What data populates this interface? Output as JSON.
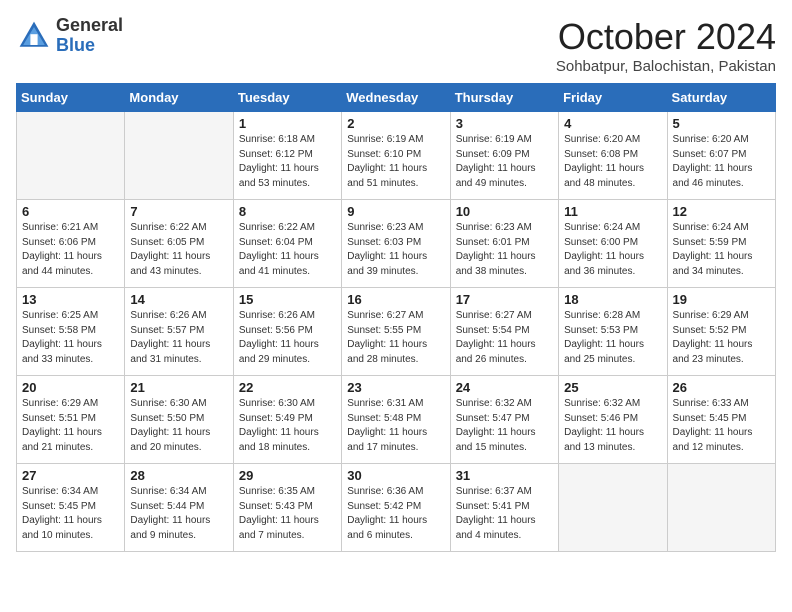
{
  "header": {
    "logo_general": "General",
    "logo_blue": "Blue",
    "month_title": "October 2024",
    "location": "Sohbatpur, Balochistan, Pakistan"
  },
  "days_of_week": [
    "Sunday",
    "Monday",
    "Tuesday",
    "Wednesday",
    "Thursday",
    "Friday",
    "Saturday"
  ],
  "weeks": [
    [
      {
        "day": "",
        "info": ""
      },
      {
        "day": "",
        "info": ""
      },
      {
        "day": "1",
        "info": "Sunrise: 6:18 AM\nSunset: 6:12 PM\nDaylight: 11 hours and 53 minutes."
      },
      {
        "day": "2",
        "info": "Sunrise: 6:19 AM\nSunset: 6:10 PM\nDaylight: 11 hours and 51 minutes."
      },
      {
        "day": "3",
        "info": "Sunrise: 6:19 AM\nSunset: 6:09 PM\nDaylight: 11 hours and 49 minutes."
      },
      {
        "day": "4",
        "info": "Sunrise: 6:20 AM\nSunset: 6:08 PM\nDaylight: 11 hours and 48 minutes."
      },
      {
        "day": "5",
        "info": "Sunrise: 6:20 AM\nSunset: 6:07 PM\nDaylight: 11 hours and 46 minutes."
      }
    ],
    [
      {
        "day": "6",
        "info": "Sunrise: 6:21 AM\nSunset: 6:06 PM\nDaylight: 11 hours and 44 minutes."
      },
      {
        "day": "7",
        "info": "Sunrise: 6:22 AM\nSunset: 6:05 PM\nDaylight: 11 hours and 43 minutes."
      },
      {
        "day": "8",
        "info": "Sunrise: 6:22 AM\nSunset: 6:04 PM\nDaylight: 11 hours and 41 minutes."
      },
      {
        "day": "9",
        "info": "Sunrise: 6:23 AM\nSunset: 6:03 PM\nDaylight: 11 hours and 39 minutes."
      },
      {
        "day": "10",
        "info": "Sunrise: 6:23 AM\nSunset: 6:01 PM\nDaylight: 11 hours and 38 minutes."
      },
      {
        "day": "11",
        "info": "Sunrise: 6:24 AM\nSunset: 6:00 PM\nDaylight: 11 hours and 36 minutes."
      },
      {
        "day": "12",
        "info": "Sunrise: 6:24 AM\nSunset: 5:59 PM\nDaylight: 11 hours and 34 minutes."
      }
    ],
    [
      {
        "day": "13",
        "info": "Sunrise: 6:25 AM\nSunset: 5:58 PM\nDaylight: 11 hours and 33 minutes."
      },
      {
        "day": "14",
        "info": "Sunrise: 6:26 AM\nSunset: 5:57 PM\nDaylight: 11 hours and 31 minutes."
      },
      {
        "day": "15",
        "info": "Sunrise: 6:26 AM\nSunset: 5:56 PM\nDaylight: 11 hours and 29 minutes."
      },
      {
        "day": "16",
        "info": "Sunrise: 6:27 AM\nSunset: 5:55 PM\nDaylight: 11 hours and 28 minutes."
      },
      {
        "day": "17",
        "info": "Sunrise: 6:27 AM\nSunset: 5:54 PM\nDaylight: 11 hours and 26 minutes."
      },
      {
        "day": "18",
        "info": "Sunrise: 6:28 AM\nSunset: 5:53 PM\nDaylight: 11 hours and 25 minutes."
      },
      {
        "day": "19",
        "info": "Sunrise: 6:29 AM\nSunset: 5:52 PM\nDaylight: 11 hours and 23 minutes."
      }
    ],
    [
      {
        "day": "20",
        "info": "Sunrise: 6:29 AM\nSunset: 5:51 PM\nDaylight: 11 hours and 21 minutes."
      },
      {
        "day": "21",
        "info": "Sunrise: 6:30 AM\nSunset: 5:50 PM\nDaylight: 11 hours and 20 minutes."
      },
      {
        "day": "22",
        "info": "Sunrise: 6:30 AM\nSunset: 5:49 PM\nDaylight: 11 hours and 18 minutes."
      },
      {
        "day": "23",
        "info": "Sunrise: 6:31 AM\nSunset: 5:48 PM\nDaylight: 11 hours and 17 minutes."
      },
      {
        "day": "24",
        "info": "Sunrise: 6:32 AM\nSunset: 5:47 PM\nDaylight: 11 hours and 15 minutes."
      },
      {
        "day": "25",
        "info": "Sunrise: 6:32 AM\nSunset: 5:46 PM\nDaylight: 11 hours and 13 minutes."
      },
      {
        "day": "26",
        "info": "Sunrise: 6:33 AM\nSunset: 5:45 PM\nDaylight: 11 hours and 12 minutes."
      }
    ],
    [
      {
        "day": "27",
        "info": "Sunrise: 6:34 AM\nSunset: 5:45 PM\nDaylight: 11 hours and 10 minutes."
      },
      {
        "day": "28",
        "info": "Sunrise: 6:34 AM\nSunset: 5:44 PM\nDaylight: 11 hours and 9 minutes."
      },
      {
        "day": "29",
        "info": "Sunrise: 6:35 AM\nSunset: 5:43 PM\nDaylight: 11 hours and 7 minutes."
      },
      {
        "day": "30",
        "info": "Sunrise: 6:36 AM\nSunset: 5:42 PM\nDaylight: 11 hours and 6 minutes."
      },
      {
        "day": "31",
        "info": "Sunrise: 6:37 AM\nSunset: 5:41 PM\nDaylight: 11 hours and 4 minutes."
      },
      {
        "day": "",
        "info": ""
      },
      {
        "day": "",
        "info": ""
      }
    ]
  ]
}
